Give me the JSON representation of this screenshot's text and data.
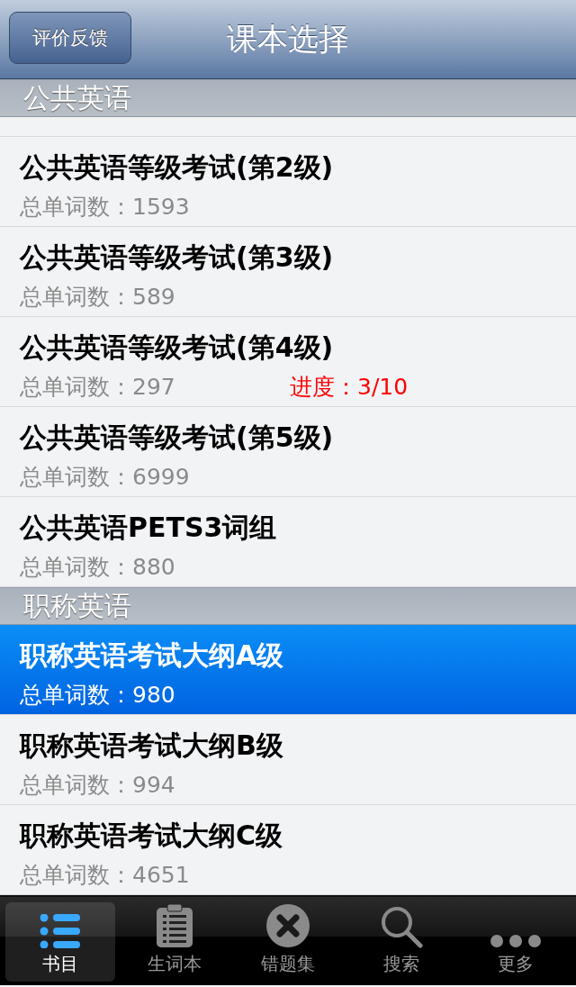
{
  "nav_bar": {
    "title": "课本选择",
    "left_button": "评价反馈"
  },
  "sections": [
    {
      "title": "公共英语",
      "rows": [
        {
          "title": "公共英语等级考试(第2级)",
          "count": "总单词数：1593",
          "selected": false
        },
        {
          "title": "公共英语等级考试(第3级)",
          "count": "总单词数：589",
          "selected": false
        },
        {
          "title": "公共英语等级考试(第4级)",
          "count": "总单词数：297",
          "progress": "进度：3/10",
          "selected": false
        },
        {
          "title": "公共英语等级考试(第5级)",
          "count": "总单词数：6999",
          "selected": false
        },
        {
          "title": "公共英语PETS3词组",
          "count": "总单词数：880",
          "selected": false
        }
      ]
    },
    {
      "title": "职称英语",
      "rows": [
        {
          "title": "职称英语考试大纲A级",
          "count": "总单词数：980",
          "selected": true
        },
        {
          "title": "职称英语考试大纲B级",
          "count": "总单词数：994",
          "selected": false
        },
        {
          "title": "职称英语考试大纲C级",
          "count": "总单词数：4651",
          "selected": false
        }
      ]
    }
  ],
  "tab_bar": [
    {
      "label": "书目",
      "kind": "list",
      "selected": true
    },
    {
      "label": "生词本",
      "kind": "clipboard",
      "selected": false
    },
    {
      "label": "错题集",
      "kind": "cross",
      "selected": false
    },
    {
      "label": "搜索",
      "kind": "search",
      "selected": false
    },
    {
      "label": "更多",
      "kind": "more",
      "selected": false
    }
  ]
}
